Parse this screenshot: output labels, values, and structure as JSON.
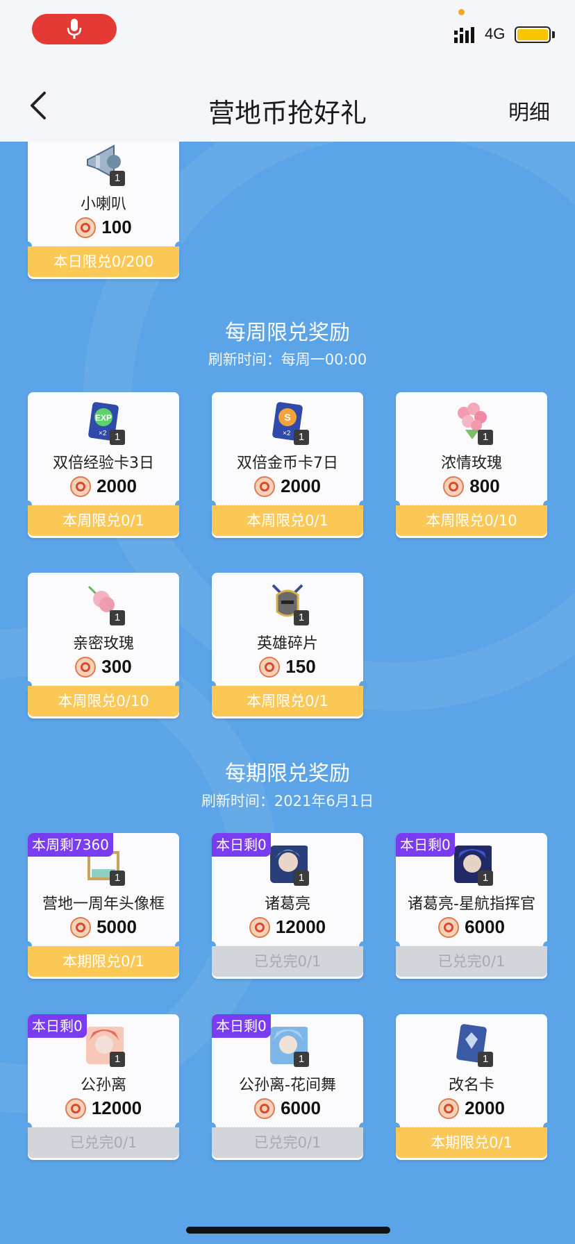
{
  "status": {
    "network": "4G"
  },
  "nav": {
    "title": "营地币抢好礼",
    "detail": "明细"
  },
  "sections": {
    "weekly": {
      "title": "每周限兑奖励",
      "refresh": "刷新时间：每周一00:00"
    },
    "period": {
      "title": "每期限兑奖励",
      "refresh": "刷新时间：2021年6月1日"
    }
  },
  "cards": {
    "c0": {
      "name": "小喇叭",
      "price": "100",
      "qty": "1",
      "limit": "本日限兑0/200",
      "icon": "megaphone-icon"
    },
    "c1": {
      "name": "双倍经验卡3日",
      "price": "2000",
      "qty": "1",
      "limit": "本周限兑0/1",
      "icon": "exp-card-icon"
    },
    "c2": {
      "name": "双倍金币卡7日",
      "price": "2000",
      "qty": "1",
      "limit": "本周限兑0/1",
      "icon": "coin-card-icon"
    },
    "c3": {
      "name": "浓情玫瑰",
      "price": "800",
      "qty": "1",
      "limit": "本周限兑0/10",
      "icon": "rose-bouquet-icon"
    },
    "c4": {
      "name": "亲密玫瑰",
      "price": "300",
      "qty": "1",
      "limit": "本周限兑0/10",
      "icon": "rose-icon"
    },
    "c5": {
      "name": "英雄碎片",
      "price": "150",
      "qty": "1",
      "limit": "本周限兑0/1",
      "icon": "hero-shard-icon"
    },
    "c6": {
      "name": "营地一周年头像框",
      "price": "5000",
      "qty": "1",
      "limit": "本期限兑0/1",
      "tag": "本周剩7360",
      "icon": "avatar-frame-icon"
    },
    "c7": {
      "name": "诸葛亮",
      "price": "12000",
      "qty": "1",
      "limit": "已兑完0/1",
      "tag": "本日剩0",
      "icon": "hero-portrait-icon"
    },
    "c8": {
      "name": "诸葛亮-星航指挥官",
      "price": "6000",
      "qty": "1",
      "limit": "已兑完0/1",
      "tag": "本日剩0",
      "icon": "skin-portrait-icon"
    },
    "c9": {
      "name": "公孙离",
      "price": "12000",
      "qty": "1",
      "limit": "已兑完0/1",
      "tag": "本日剩0",
      "icon": "hero-portrait-icon"
    },
    "c10": {
      "name": "公孙离-花间舞",
      "price": "6000",
      "qty": "1",
      "limit": "已兑完0/1",
      "tag": "本日剩0",
      "icon": "skin-portrait-icon"
    },
    "c11": {
      "name": "改名卡",
      "price": "2000",
      "qty": "1",
      "limit": "本期限兑0/1",
      "icon": "rename-card-icon"
    }
  },
  "colors": {
    "accent_gold": "#fcc855",
    "sold_out_grey": "#d2d5da",
    "tag_purple": "#7a3cf0",
    "background_blue": "#5ba4e7"
  }
}
